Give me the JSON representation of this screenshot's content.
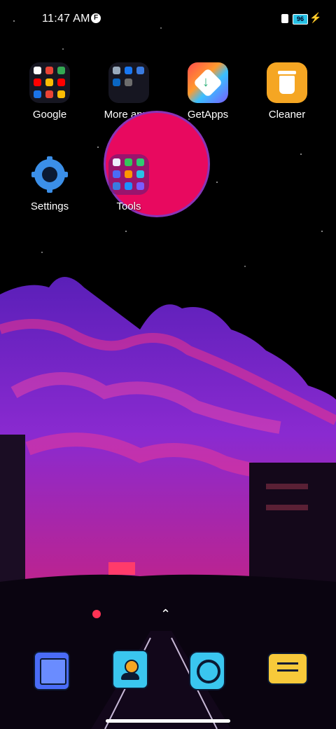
{
  "status_bar": {
    "time": "11:47 AM",
    "notification_badge": "F",
    "battery_level": "96",
    "icons": [
      "sim-icon",
      "battery-icon",
      "charging-bolt-icon"
    ]
  },
  "home_apps": [
    {
      "label": "Google",
      "kind": "folder"
    },
    {
      "label": "More apps",
      "kind": "folder"
    },
    {
      "label": "GetApps",
      "kind": "app"
    },
    {
      "label": "Cleaner",
      "kind": "app"
    },
    {
      "label": "Settings",
      "kind": "app"
    },
    {
      "label": "Tools",
      "kind": "folder"
    }
  ],
  "dock": {
    "apps": [
      "tablet-icon",
      "contacts-icon",
      "browser-icon",
      "messages-icon"
    ]
  },
  "colors": {
    "accent_pink": "#e8095f",
    "sky_purple": "#7a2ad6",
    "battery_blue": "#27c2e6"
  }
}
